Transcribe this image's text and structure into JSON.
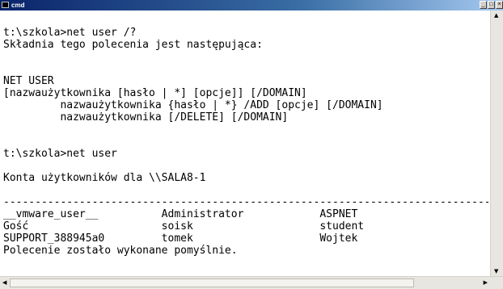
{
  "window": {
    "title": "cmd",
    "buttons": {
      "minimize": "_",
      "maximize": "□",
      "close": "×"
    }
  },
  "console": {
    "lines": [
      "",
      "t:\\szkola>net user /?",
      "Składnia tego polecenia jest następująca:",
      "",
      "",
      "NET USER",
      "[nazwaużytkownika [hasło | *] [opcje]] [/DOMAIN]",
      "         nazwaużytkownika {hasło | *} /ADD [opcje] [/DOMAIN]",
      "         nazwaużytkownika [/DELETE] [/DOMAIN]",
      "",
      "",
      "t:\\szkola>net user",
      "",
      "Konta użytkowników dla \\\\SALA8-1",
      "",
      "-------------------------------------------------------------------------------",
      "__vmware_user__          Administrator            ASPNET",
      "Gość                     soisk                    student",
      "SUPPORT_388945a0         tomek                    Wojtek",
      "Polecenie zostało wykonane pomyślnie.",
      "",
      ""
    ]
  },
  "scrollbars": {
    "up": "▲",
    "down": "▼",
    "left": "◀",
    "right": "▶"
  }
}
